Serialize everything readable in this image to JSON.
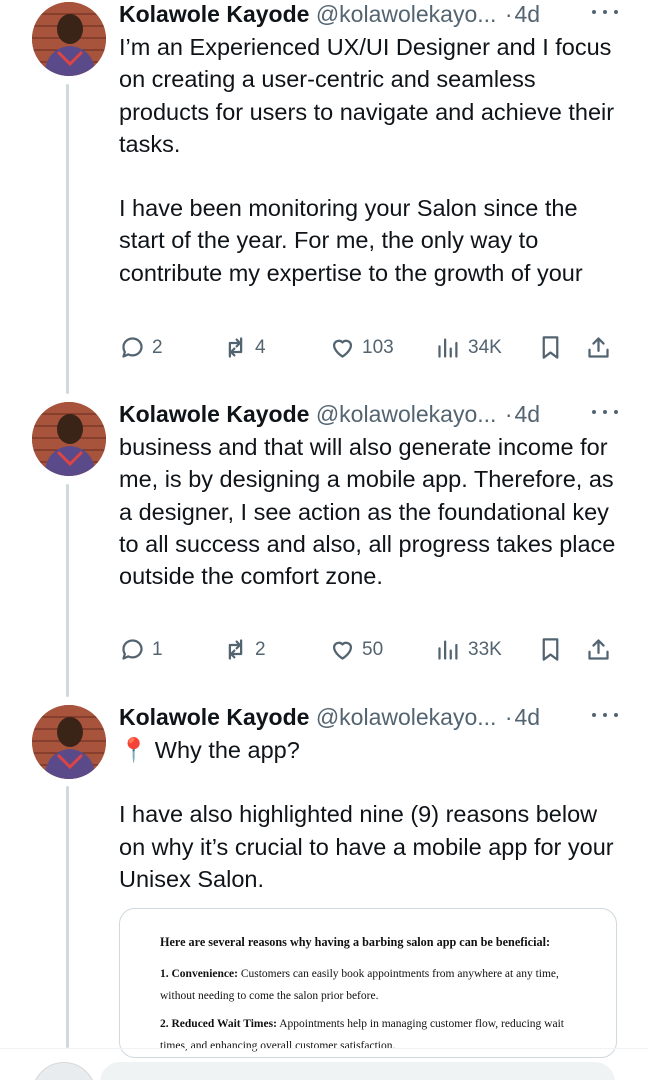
{
  "tweets": [
    {
      "name": "Kolawole Kayode",
      "handle": "@kolawolekayo...",
      "dot": "·",
      "time": "4d",
      "paragraphs": [
        "I’m an Experienced UX/UI Designer and I focus on creating a user-centric and seamless products for users to navigate and achieve their tasks.",
        "I have been monitoring your Salon since the start of the year. For me, the only way to contribute my expertise to the growth of your"
      ],
      "replies": "2",
      "reposts": "4",
      "likes": "103",
      "views": "34K"
    },
    {
      "name": "Kolawole Kayode",
      "handle": "@kolawolekayo...",
      "dot": "·",
      "time": "4d",
      "paragraphs": [
        "business and that will also generate income for me, is by designing a mobile app. Therefore, as a designer, I see action as the foundational key to all success and also, all progress takes place outside the comfort zone."
      ],
      "replies": "1",
      "reposts": "2",
      "likes": "50",
      "views": "33K"
    },
    {
      "name": "Kolawole Kayode",
      "handle": "@kolawolekayo...",
      "dot": "·",
      "time": "4d",
      "pin_emoji": "📍",
      "line1": "Why the app?",
      "paragraphs": [
        "I have also highlighted nine (9) reasons below on why it’s crucial to have a mobile app for your Unisex Salon."
      ]
    }
  ],
  "media": {
    "heading": "Here are several reasons why having a barbing salon app can be beneficial:",
    "items": [
      {
        "label": "1. Convenience:",
        "text": "Customers can easily book appointments from anywhere at any time, without needing to come the salon prior before."
      },
      {
        "label": "2. Reduced Wait Times:",
        "text": "Appointments help in managing customer flow, reducing wait times, and enhancing overall customer satisfaction."
      }
    ]
  },
  "icons": {
    "reply": "reply-icon",
    "repost": "repost-icon",
    "like": "heart-icon",
    "views": "views-icon",
    "bookmark": "bookmark-icon",
    "share": "share-icon",
    "more": "more-icon"
  },
  "colors": {
    "text": "#0f1419",
    "muted": "#536471",
    "thread": "#cfd9de"
  }
}
